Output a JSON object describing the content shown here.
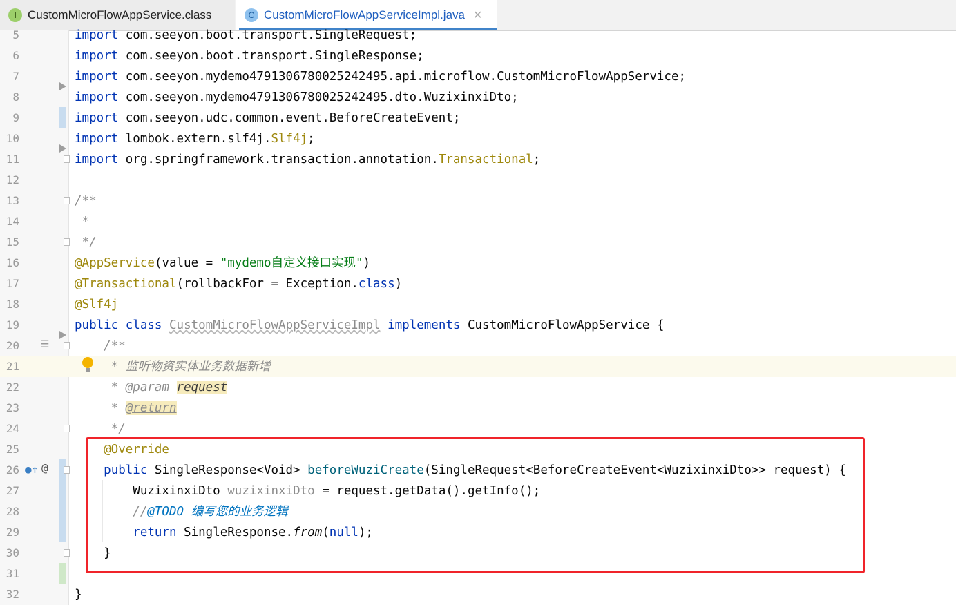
{
  "tabs": [
    {
      "icon": "I",
      "label": "CustomMicroFlowAppService.class"
    },
    {
      "icon": "C",
      "label": "CustomMicroFlowAppServiceImpl.java",
      "close": "✕"
    }
  ],
  "editor": {
    "line_numbers": [
      "5",
      "6",
      "7",
      "8",
      "9",
      "10",
      "11",
      "12",
      "13",
      "14",
      "15",
      "16",
      "17",
      "18",
      "19",
      "20",
      "21",
      "22",
      "23",
      "24",
      "25",
      "26",
      "27",
      "28",
      "29",
      "30",
      "31",
      "32"
    ],
    "lines": {
      "l5": [
        "import",
        " com.seeyon.boot.transport.SingleRequest;"
      ],
      "l6": [
        "import",
        " com.seeyon.boot.transport.SingleResponse;"
      ],
      "l7": [
        "import",
        " com.seeyon.mydemo4791306780025242495.api.microflow.CustomMicroFlowAppService;"
      ],
      "l8": [
        "import",
        " com.seeyon.mydemo4791306780025242495.dto.WuzixinxiDto;"
      ],
      "l9": [
        "import",
        " com.seeyon.udc.common.event.BeforeCreateEvent;"
      ],
      "l10": [
        "import",
        " lombok.extern.slf4j.",
        "Slf4j",
        ";"
      ],
      "l11": [
        "import",
        " org.springframework.transaction.annotation.",
        "Transactional",
        ";"
      ],
      "l13": "/**",
      "l14": " *",
      "l15": " */",
      "l16": [
        "@AppService",
        "(value = ",
        "\"mydemo自定义接口实现\"",
        ")"
      ],
      "l17": [
        "@Transactional",
        "(rollbackFor = Exception.",
        "class",
        ")"
      ],
      "l18": "@Slf4j",
      "l19": [
        "public",
        " ",
        "class",
        " ",
        "CustomMicroFlowAppServiceImpl",
        " ",
        "implements",
        " CustomMicroFlowAppService {"
      ],
      "l20": "    /**",
      "l21": "     * 监听物资实体业务数据新增",
      "l22": [
        "     * ",
        "@param",
        " ",
        "request"
      ],
      "l23": [
        "     * ",
        "@return"
      ],
      "l24": "     */",
      "l25": "    @Override",
      "l26": [
        "    ",
        "public",
        " SingleResponse<Void> ",
        "beforeWuziCreate",
        "(SingleRequest<BeforeCreateEvent<WuzixinxiDto>> request) {"
      ],
      "l27": [
        "        WuzixinxiDto ",
        "wuzixinxiDto",
        " = request.getData().getInfo();"
      ],
      "l28": [
        "        //",
        "@TODO 编写您的业务逻辑"
      ],
      "l29": [
        "        ",
        "return",
        " SingleResponse.",
        "from",
        "(",
        "null",
        ");"
      ],
      "l30": "    }",
      "l32": "}"
    }
  },
  "colors": {
    "keyword": "#0033b3",
    "annotation": "#9e880d",
    "string": "#067d17",
    "comment": "#8c8c8c",
    "todo": "#0073bf",
    "highlight_box": "#f0242a"
  },
  "gutter_icons": [
    "override-arrow-icon",
    "at-icon",
    "bulb-icon",
    "fold-icon",
    "structure-icon"
  ]
}
